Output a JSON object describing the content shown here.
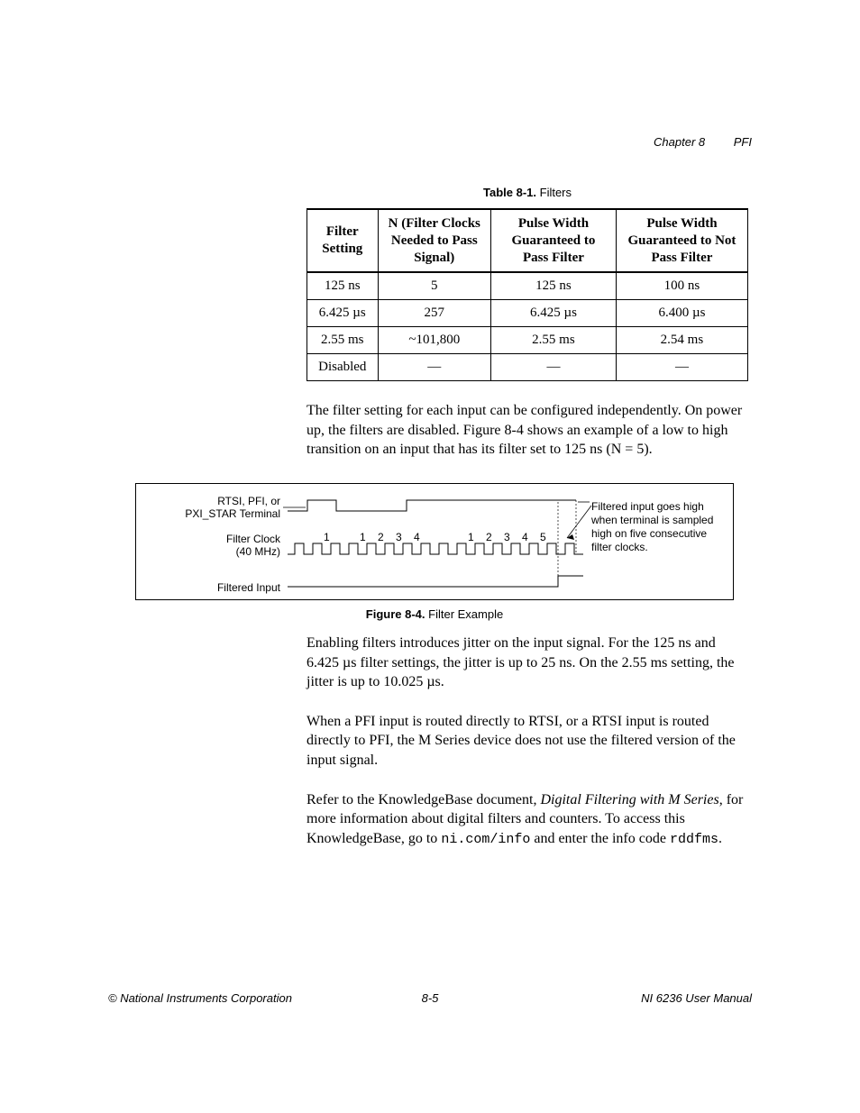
{
  "header": {
    "chapter": "Chapter 8",
    "title": "PFI"
  },
  "table": {
    "caption_label": "Table 8-1.",
    "caption_title": "Filters",
    "headers": [
      "Filter Setting",
      "N (Filter Clocks Needed to Pass Signal)",
      "Pulse Width Guaranteed to Pass Filter",
      "Pulse Width Guaranteed to Not Pass Filter"
    ],
    "rows": [
      {
        "c0": "125 ns",
        "c1": "5",
        "c2": "125 ns",
        "c3": "100 ns"
      },
      {
        "c0": "6.425 µs",
        "c1": "257",
        "c2": "6.425 µs",
        "c3": "6.400 µs"
      },
      {
        "c0": "2.55 ms",
        "c1": "~101,800",
        "c2": "2.55 ms",
        "c3": "2.54 ms"
      },
      {
        "c0": "Disabled",
        "c1": "—",
        "c2": "—",
        "c3": "—"
      }
    ]
  },
  "paragraphs": {
    "p1": "The filter setting for each input can be configured independently. On power up, the filters are disabled. Figure 8-4 shows an example of a low to high transition on an input that has its filter set to 125 ns (N = 5).",
    "p2": "Enabling filters introduces jitter on the input signal. For the 125 ns and 6.425 µs filter settings, the jitter is up to 25 ns. On the 2.55 ms setting, the jitter is up to 10.025 µs.",
    "p3": "When a PFI input is routed directly to RTSI, or a RTSI input is routed directly to PFI, the M Series device does not use the filtered version of the input signal.",
    "p4_a": "Refer to the KnowledgeBase document, ",
    "p4_title": "Digital Filtering with M Series",
    "p4_b": ", for more information about digital filters and counters. To access this KnowledgeBase, go to ",
    "p4_code1": "ni.com/info",
    "p4_c": " and enter the info code ",
    "p4_code2": "rddfms",
    "p4_d": "."
  },
  "figure": {
    "caption_label": "Figure 8-4.",
    "caption_title": "Filter Example",
    "labels": {
      "terminal_l1": "RTSI, PFI, or",
      "terminal_l2": "PXI_STAR Terminal",
      "clock_l1": "Filter Clock",
      "clock_l2": "(40 MHz)",
      "filtered": "Filtered Input",
      "note": "Filtered input goes high when terminal is sampled high on five consecutive filter clocks."
    },
    "ticks_a": [
      "1"
    ],
    "ticks_b": [
      "1",
      "2",
      "3",
      "4"
    ],
    "ticks_c": [
      "1",
      "2",
      "3",
      "4",
      "5"
    ]
  },
  "footer": {
    "left": "© National Instruments Corporation",
    "center": "8-5",
    "right": "NI 6236 User Manual"
  },
  "chart_data": {
    "type": "table",
    "title": "Filters",
    "columns": [
      "Filter Setting",
      "N (Filter Clocks Needed to Pass Signal)",
      "Pulse Width Guaranteed to Pass Filter",
      "Pulse Width Guaranteed to Not Pass Filter"
    ],
    "rows": [
      [
        "125 ns",
        "5",
        "125 ns",
        "100 ns"
      ],
      [
        "6.425 µs",
        "257",
        "6.425 µs",
        "6.400 µs"
      ],
      [
        "2.55 ms",
        "~101,800",
        "2.55 ms",
        "2.54 ms"
      ],
      [
        "Disabled",
        "—",
        "—",
        "—"
      ]
    ]
  }
}
